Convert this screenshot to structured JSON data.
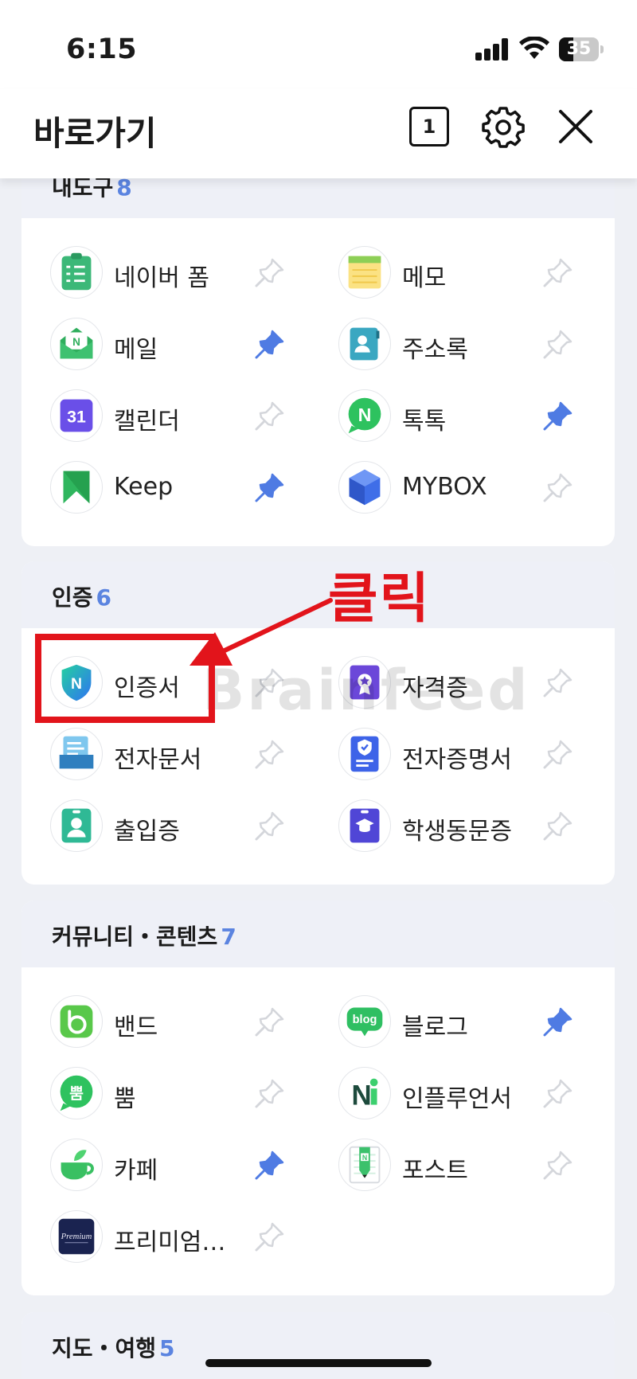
{
  "status": {
    "time": "6:15",
    "battery": "35",
    "battery_level": 0.35
  },
  "header": {
    "title": "바로가기",
    "tab_count": "1"
  },
  "sections": [
    {
      "title": "내도구",
      "count": "8",
      "items": [
        {
          "label": "네이버 폼",
          "icon": "naver-form-icon",
          "pinned": false
        },
        {
          "label": "메모",
          "icon": "memo-icon",
          "pinned": false
        },
        {
          "label": "메일",
          "icon": "mail-icon",
          "pinned": true
        },
        {
          "label": "주소록",
          "icon": "contacts-icon",
          "pinned": false
        },
        {
          "label": "캘린더",
          "icon": "calendar-icon",
          "icon_text": "31",
          "pinned": false
        },
        {
          "label": "톡톡",
          "icon": "talktalk-icon",
          "icon_text": "N",
          "pinned": true
        },
        {
          "label": "Keep",
          "icon": "keep-icon",
          "pinned": true
        },
        {
          "label": "MYBOX",
          "icon": "mybox-icon",
          "pinned": false
        }
      ]
    },
    {
      "title": "인증",
      "count": "6",
      "items": [
        {
          "label": "인증서",
          "icon": "certificate-shield-icon",
          "icon_text": "N",
          "pinned": false
        },
        {
          "label": "자격증",
          "icon": "license-icon",
          "pinned": false
        },
        {
          "label": "전자문서",
          "icon": "e-document-icon",
          "pinned": false
        },
        {
          "label": "전자증명서",
          "icon": "e-certificate-icon",
          "pinned": false
        },
        {
          "label": "출입증",
          "icon": "access-pass-icon",
          "pinned": false
        },
        {
          "label": "학생동문증",
          "icon": "student-alumni-card-icon",
          "pinned": false
        }
      ]
    },
    {
      "title": "커뮤니티・콘텐츠",
      "count": "7",
      "items": [
        {
          "label": "밴드",
          "icon": "band-icon",
          "icon_text": "b",
          "pinned": false
        },
        {
          "label": "블로그",
          "icon": "blog-icon",
          "icon_text": "blog",
          "pinned": true
        },
        {
          "label": "뿜",
          "icon": "ppum-icon",
          "icon_text": "뿜",
          "pinned": false
        },
        {
          "label": "인플루언서",
          "icon": "influencer-icon",
          "icon_text": "N",
          "pinned": false
        },
        {
          "label": "카페",
          "icon": "cafe-icon",
          "pinned": true
        },
        {
          "label": "포스트",
          "icon": "post-icon",
          "icon_text": "N",
          "pinned": false
        },
        {
          "label": "프리미엄…",
          "icon": "premium-contents-icon",
          "icon_text": "Premium",
          "pinned": false
        }
      ]
    },
    {
      "title": "지도・여행",
      "count": "5",
      "items": []
    }
  ],
  "annotation": {
    "text": "클릭"
  },
  "watermark": "Brainfeed",
  "colors": {
    "accent": "#5b84e0",
    "pin_active": "#4f7be3",
    "pin_inactive": "#d4d6db",
    "annotation": "#e2141b",
    "section_header_bg": "#eef0f7"
  }
}
